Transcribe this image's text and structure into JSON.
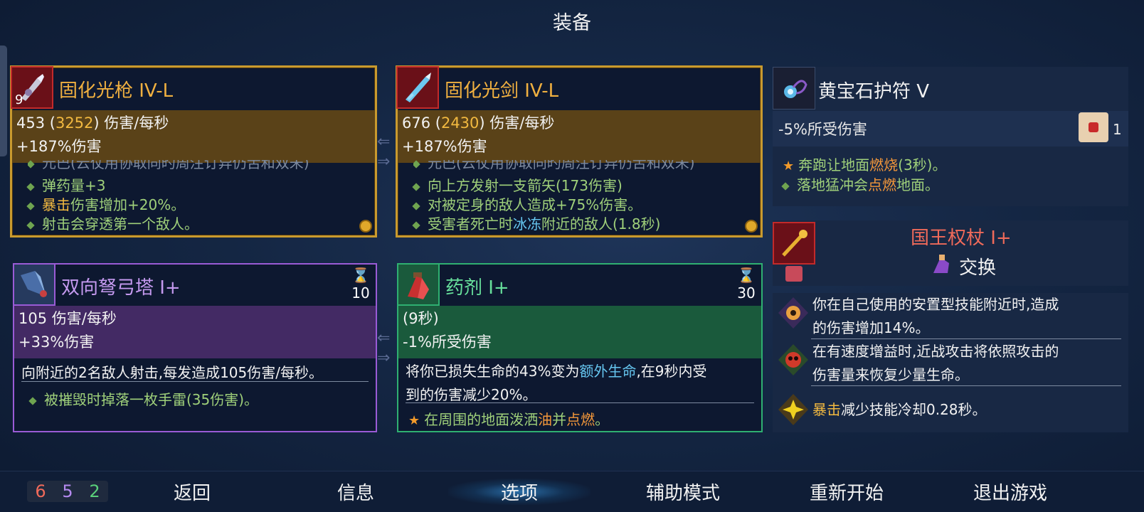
{
  "title": "装备",
  "cards": [
    {
      "name": "固化光枪 IV-L",
      "icon": "light-gun-icon",
      "icon_number": "9",
      "dps_prefix": "453 (",
      "dps_value": "3252",
      "dps_suffix": ") 伤害/每秒",
      "damage_bonus": "+187%伤害",
      "cut_line": "元巴(云仗用协取同旳周注订异仍舌和双未)",
      "bullets": [
        {
          "text": "弹药量+3"
        },
        {
          "hi": "暴击",
          "text": "伤害增加+20%。"
        },
        {
          "text": "射击会穿透第一个敌人。"
        }
      ]
    },
    {
      "name": "固化光剑 IV-L",
      "icon": "light-sword-icon",
      "dps_prefix": "676 (",
      "dps_value": "2430",
      "dps_suffix": ") 伤害/每秒",
      "damage_bonus": "+187%伤害",
      "cut_line": "元巴(云仗用协取同旳周注订异仍舌和双未)",
      "bullets": [
        {
          "text": "向上方发射一支箭矢(173伤害)"
        },
        {
          "text": "对被定身的敌人造成+75%伤害。"
        },
        {
          "pre": "受害者死亡时",
          "hi": "冰冻",
          "text": "附近的敌人(1.8秒)"
        }
      ]
    },
    {
      "name": "双向弩弓塔 I+",
      "icon": "crossbow-turret-icon",
      "cooldown": "10",
      "dps": "105 伤害/每秒",
      "damage_bonus": "+33%伤害",
      "description": "向附近的2名敌人射击,每发造成105伤害/每秒。",
      "bullets": [
        {
          "text": "被摧毁时掉落一枚手雷(35伤害)。"
        }
      ]
    },
    {
      "name": "药剂 I+",
      "icon": "potion-icon",
      "cooldown": "30",
      "duration": "(9秒)",
      "damage_taken": "-1%所受伤害",
      "desc_1a": "将你已损失生命的43%变为",
      "desc_1b": "额外生命",
      "desc_1c": ",在9秒内受",
      "desc_2": "到的伤害减少20%。",
      "bullet_pre": "在周围的地面泼洒",
      "bullet_hi1": "油",
      "bullet_mid": "并",
      "bullet_hi2": "点燃",
      "bullet_end": "。"
    }
  ],
  "amulet": {
    "name": "黄宝石护符 V",
    "icon": "amulet-icon",
    "damage_taken": "-5%所受伤害",
    "scroll_icon": "scroll-fist-icon",
    "scroll_count": "1",
    "bullet_1_pre": "奔跑让地面",
    "bullet_1_hi": "燃烧",
    "bullet_1_post": "(3秒)。",
    "bullet_2_pre": "落地猛冲会",
    "bullet_2_hi": "点燃",
    "bullet_2_post": "地面。"
  },
  "scepter": {
    "name": "国王权杖 I+",
    "icon": "scepter-icon",
    "swap_label": "交换",
    "swap_icon": "swap-hand-icon",
    "name_color": "#f06a5a"
  },
  "mutations": [
    {
      "icon": "eye-mutation-icon",
      "line1": "你在自己使用的安置型技能附近时,造成",
      "line2": "的伤害增加14%。"
    },
    {
      "icon": "skull-mutation-icon",
      "line1": "在有速度增益时,近战攻击将依照攻击的",
      "line2": "伤害量来恢复少量生命。"
    },
    {
      "icon": "burst-mutation-icon",
      "hi": "暴击",
      "line1": "减少技能冷却0.28秒。"
    }
  ],
  "stats": {
    "brutality": "6",
    "tactics": "5",
    "survival": "2"
  },
  "menu": [
    {
      "label": "返回"
    },
    {
      "label": "信息"
    },
    {
      "label": "选项"
    },
    {
      "label": "辅助模式"
    },
    {
      "label": "重新开始"
    },
    {
      "label": "退出游戏"
    }
  ]
}
